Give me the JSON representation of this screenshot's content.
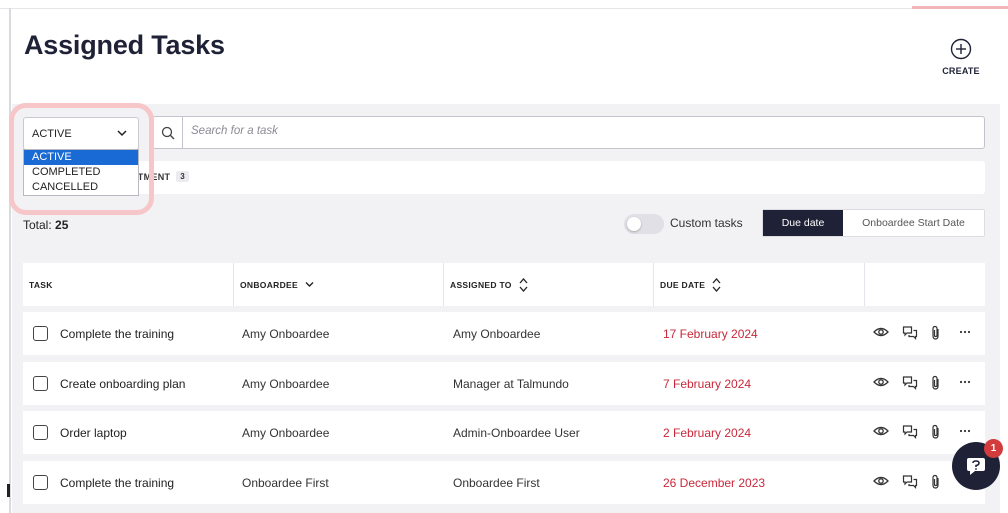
{
  "page": {
    "title": "Assigned Tasks"
  },
  "header": {
    "create_label": "CREATE"
  },
  "filters": {
    "status_value": "ACTIVE",
    "status_options": [
      "ACTIVE",
      "COMPLETED",
      "CANCELLED"
    ],
    "search_placeholder": "Search for a task",
    "chip_label": "RTMENT",
    "chip_count": "3"
  },
  "summary": {
    "total_label": "Total:",
    "total_value": "25"
  },
  "view": {
    "custom_tasks_label": "Custom tasks",
    "custom_tasks_on": false,
    "sort_options": [
      "Due date",
      "Onboardee Start Date"
    ],
    "active_sort": "Due date"
  },
  "table": {
    "columns": [
      "TASK",
      "ONBOARDEE",
      "ASSIGNED TO",
      "DUE DATE"
    ],
    "rows": [
      {
        "task": "Complete the training",
        "onboardee": "Amy Onboardee",
        "assigned_to": "Amy Onboardee",
        "due_date": "17 February 2024"
      },
      {
        "task": "Create onboarding plan",
        "onboardee": "Amy Onboardee",
        "assigned_to": "Manager at Talmundo",
        "due_date": "7 February 2024"
      },
      {
        "task": "Order laptop",
        "onboardee": "Amy Onboardee",
        "assigned_to": "Admin-Onboardee User",
        "due_date": "2 February 2024"
      },
      {
        "task": "Complete the training",
        "onboardee": "Onboardee First",
        "assigned_to": "Onboardee First",
        "due_date": "26 December 2023"
      }
    ],
    "row_actions": [
      "eye-icon",
      "comments-icon",
      "paperclip-icon",
      "more-icon"
    ]
  },
  "help": {
    "badge_count": "1"
  },
  "colors": {
    "primary": "#1f2237",
    "due_date": "#c8283a",
    "highlight": "#f6c6c8",
    "selected_option": "#1a6ad6"
  }
}
